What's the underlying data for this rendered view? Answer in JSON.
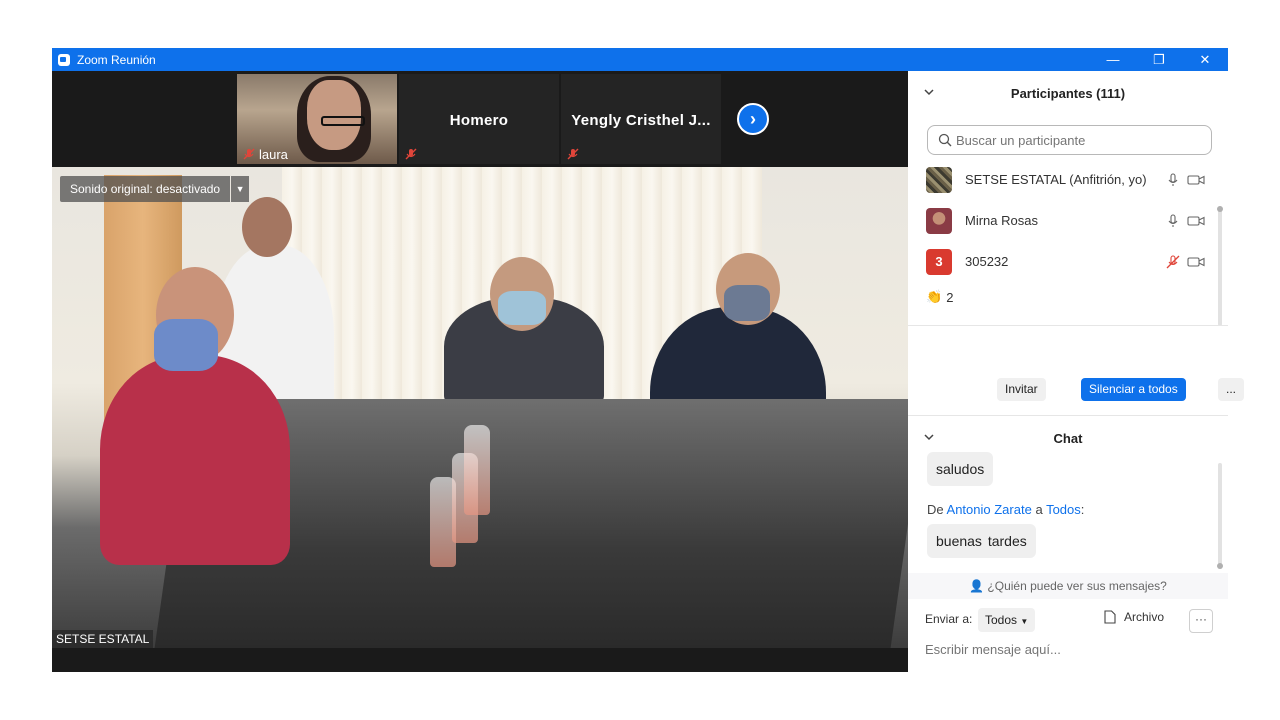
{
  "window": {
    "title": "Zoom Reunión",
    "controls": [
      "—",
      "❐",
      "✕"
    ]
  },
  "thumbnails": [
    {
      "name": "laura",
      "muted": true,
      "has_video": true
    },
    {
      "name": "Homero",
      "muted": true,
      "has_video": false
    },
    {
      "name": "Yengly Cristhel J...",
      "muted": true,
      "has_video": false
    }
  ],
  "main_video": {
    "sound_label": "Sonido original: desactivado",
    "speaker": "SETSE ESTATAL"
  },
  "participants": {
    "title": "Participantes (111)",
    "search_placeholder": "Buscar un participante",
    "list": [
      {
        "name": "SETSE ESTATAL (Anfitrión, yo)",
        "avatar": "photo",
        "mic": "on"
      },
      {
        "name": "Mirna Rosas",
        "avatar": "photo",
        "mic": "on"
      },
      {
        "name": "305232",
        "avatar": "3",
        "avatar_color": "#d93a2f",
        "mic": "muted"
      }
    ],
    "reaction_count": "2",
    "invite_label": "Invitar",
    "mute_all_label": "Silenciar a todos",
    "more_label": "..."
  },
  "chat": {
    "title": "Chat",
    "messages": [
      {
        "text": "saludos"
      },
      {
        "from_prefix": "De",
        "from": "Antonio Zarate",
        "to_sep": "a",
        "to": "Todos",
        "to_suffix": ":",
        "text": "buenas  tardes"
      }
    ],
    "who_can_see": "¿Quién puede ver sus mensajes?",
    "send_to_label": "Enviar a:",
    "send_to_value": "Todos",
    "file_label": "Archivo",
    "more_label": "···",
    "input_placeholder": "Escribir mensaje aquí..."
  },
  "colors": {
    "accent": "#0e71eb",
    "muted_red": "#e0453a"
  }
}
